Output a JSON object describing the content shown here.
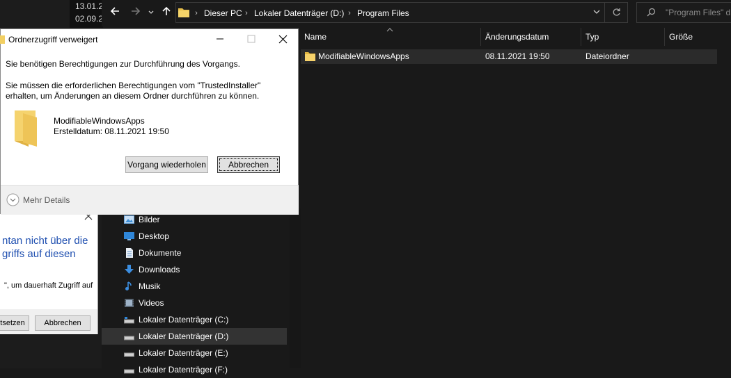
{
  "background": {
    "dates": [
      "13.01.2",
      "02.09.2"
    ],
    "dialog2": {
      "line1": "ntan nicht über die",
      "line2": "griffs auf diesen",
      "line3": "\", um dauerhaft Zugriff auf",
      "btn_left": "tsetzen",
      "btn_cancel": "Abbrechen"
    }
  },
  "explorer": {
    "breadcrumb": [
      "Dieser PC",
      "Lokaler Datenträger (D:)",
      "Program Files"
    ],
    "search_placeholder": "\"Program Files\" du",
    "columns": [
      "Name",
      "Änderungsdatum",
      "Typ",
      "Größe"
    ],
    "rows": [
      {
        "name": "ModifiableWindowsApps",
        "date": "08.11.2021 19:50",
        "type": "Dateiordner",
        "size": ""
      }
    ],
    "nav": [
      {
        "label": "Bilder",
        "icon": "pictures-icon"
      },
      {
        "label": "Desktop",
        "icon": "desktop-icon"
      },
      {
        "label": "Dokumente",
        "icon": "documents-icon"
      },
      {
        "label": "Downloads",
        "icon": "downloads-icon"
      },
      {
        "label": "Musik",
        "icon": "music-icon"
      },
      {
        "label": "Videos",
        "icon": "videos-icon"
      },
      {
        "label": "Lokaler Datenträger (C:)",
        "icon": "drive-icon"
      },
      {
        "label": "Lokaler Datenträger (D:)",
        "icon": "drive-icon"
      },
      {
        "label": "Lokaler Datenträger (E:)",
        "icon": "drive-icon"
      },
      {
        "label": "Lokaler Datenträger (F:)",
        "icon": "drive-icon"
      }
    ]
  },
  "dialog": {
    "title": "Ordnerzugriff verweigert",
    "line1": "Sie benötigen Berechtigungen zur Durchführung des Vorgangs.",
    "line2": "Sie müssen die erforderlichen Berechtigungen vom \"TrustedInstaller\"",
    "line3": "erhalten, um Änderungen an diesem Ordner durchführen zu können.",
    "folder_name": "ModifiableWindowsApps",
    "created": "Erstelldatum: 08.11.2021 19:50",
    "btn_retry": "Vorgang wiederholen",
    "btn_cancel": "Abbrechen",
    "more_details": "Mehr Details"
  }
}
